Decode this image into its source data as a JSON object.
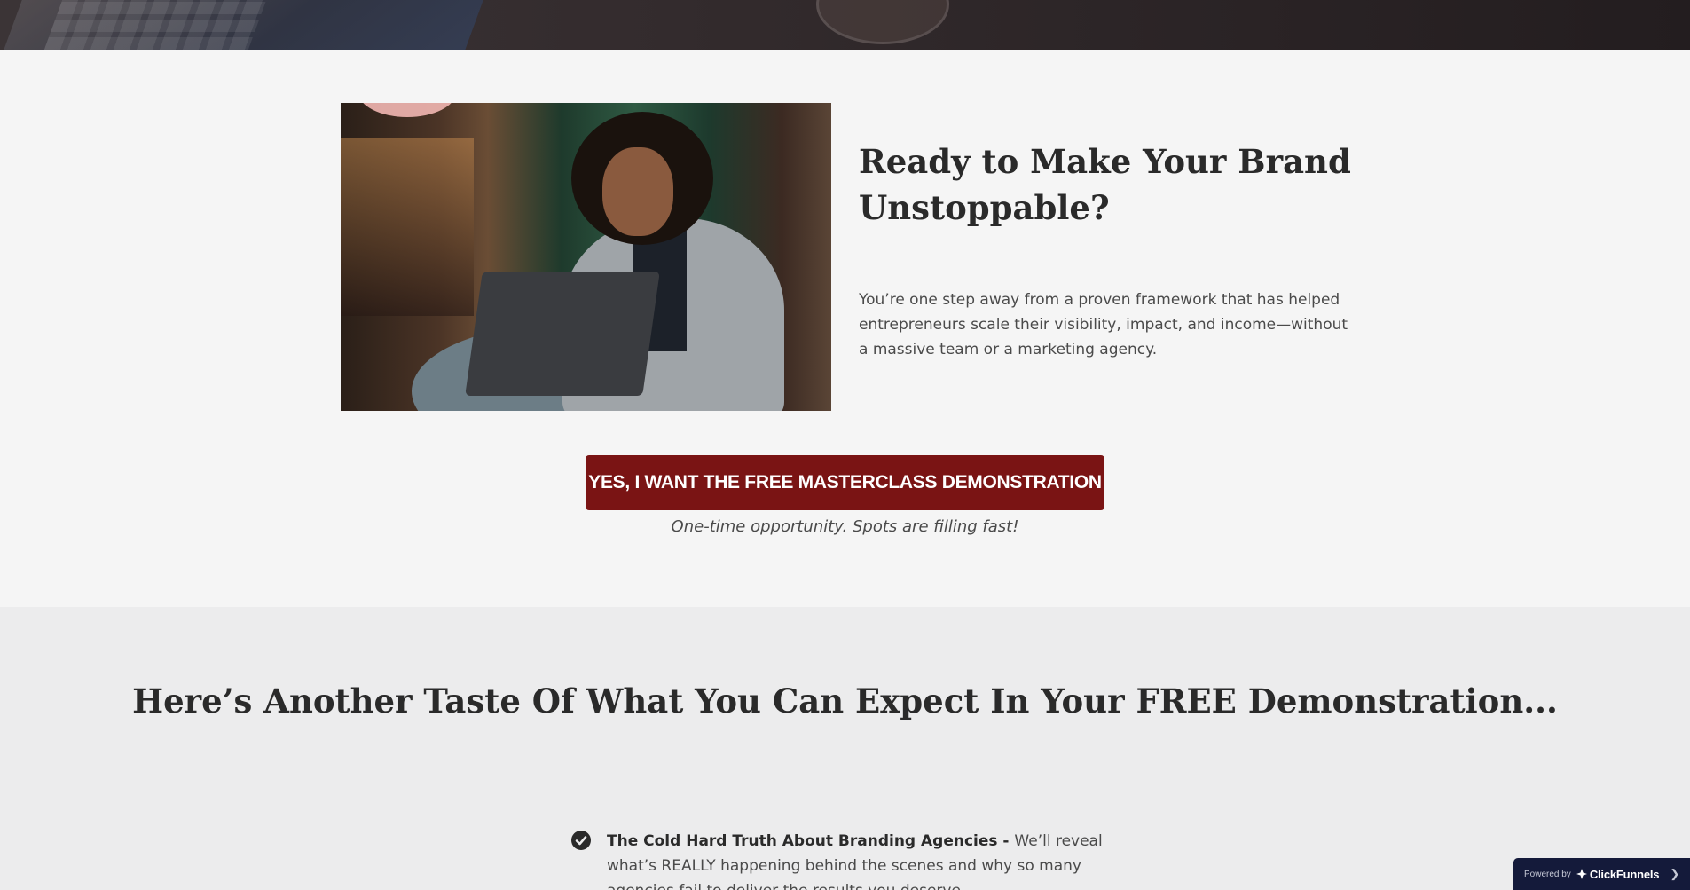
{
  "cta_section": {
    "heading": "Ready to Make Your Brand Unstoppable?",
    "body": "You’re one step away from a proven framework that has helped entrepreneurs scale their visibility, impact, and income—without a massive team or a marketing agency.",
    "button_label": "YES, I WANT THE FREE MASTERCLASS DEMONSTRATION",
    "note": "One-time opportunity. Spots are filling fast!"
  },
  "demo_section": {
    "heading": "Here’s Another Taste Of What You Can Expect In Your FREE Demonstration...",
    "bullets": [
      {
        "title": "The Cold Hard Truth About Branding Agencies - ",
        "text": "We’ll reveal what’s REALLY happening behind the scenes and why so many agencies fail to deliver the results you deserve."
      }
    ]
  },
  "badge": {
    "powered_by": "Powered by",
    "brand": "ClickFunnels",
    "icon": "chevron-right-icon"
  },
  "colors": {
    "button": "#7a1414",
    "badge_background": "#141a3a",
    "section_one_bg": "#f5f5f5",
    "section_two_bg": "#ececed"
  }
}
